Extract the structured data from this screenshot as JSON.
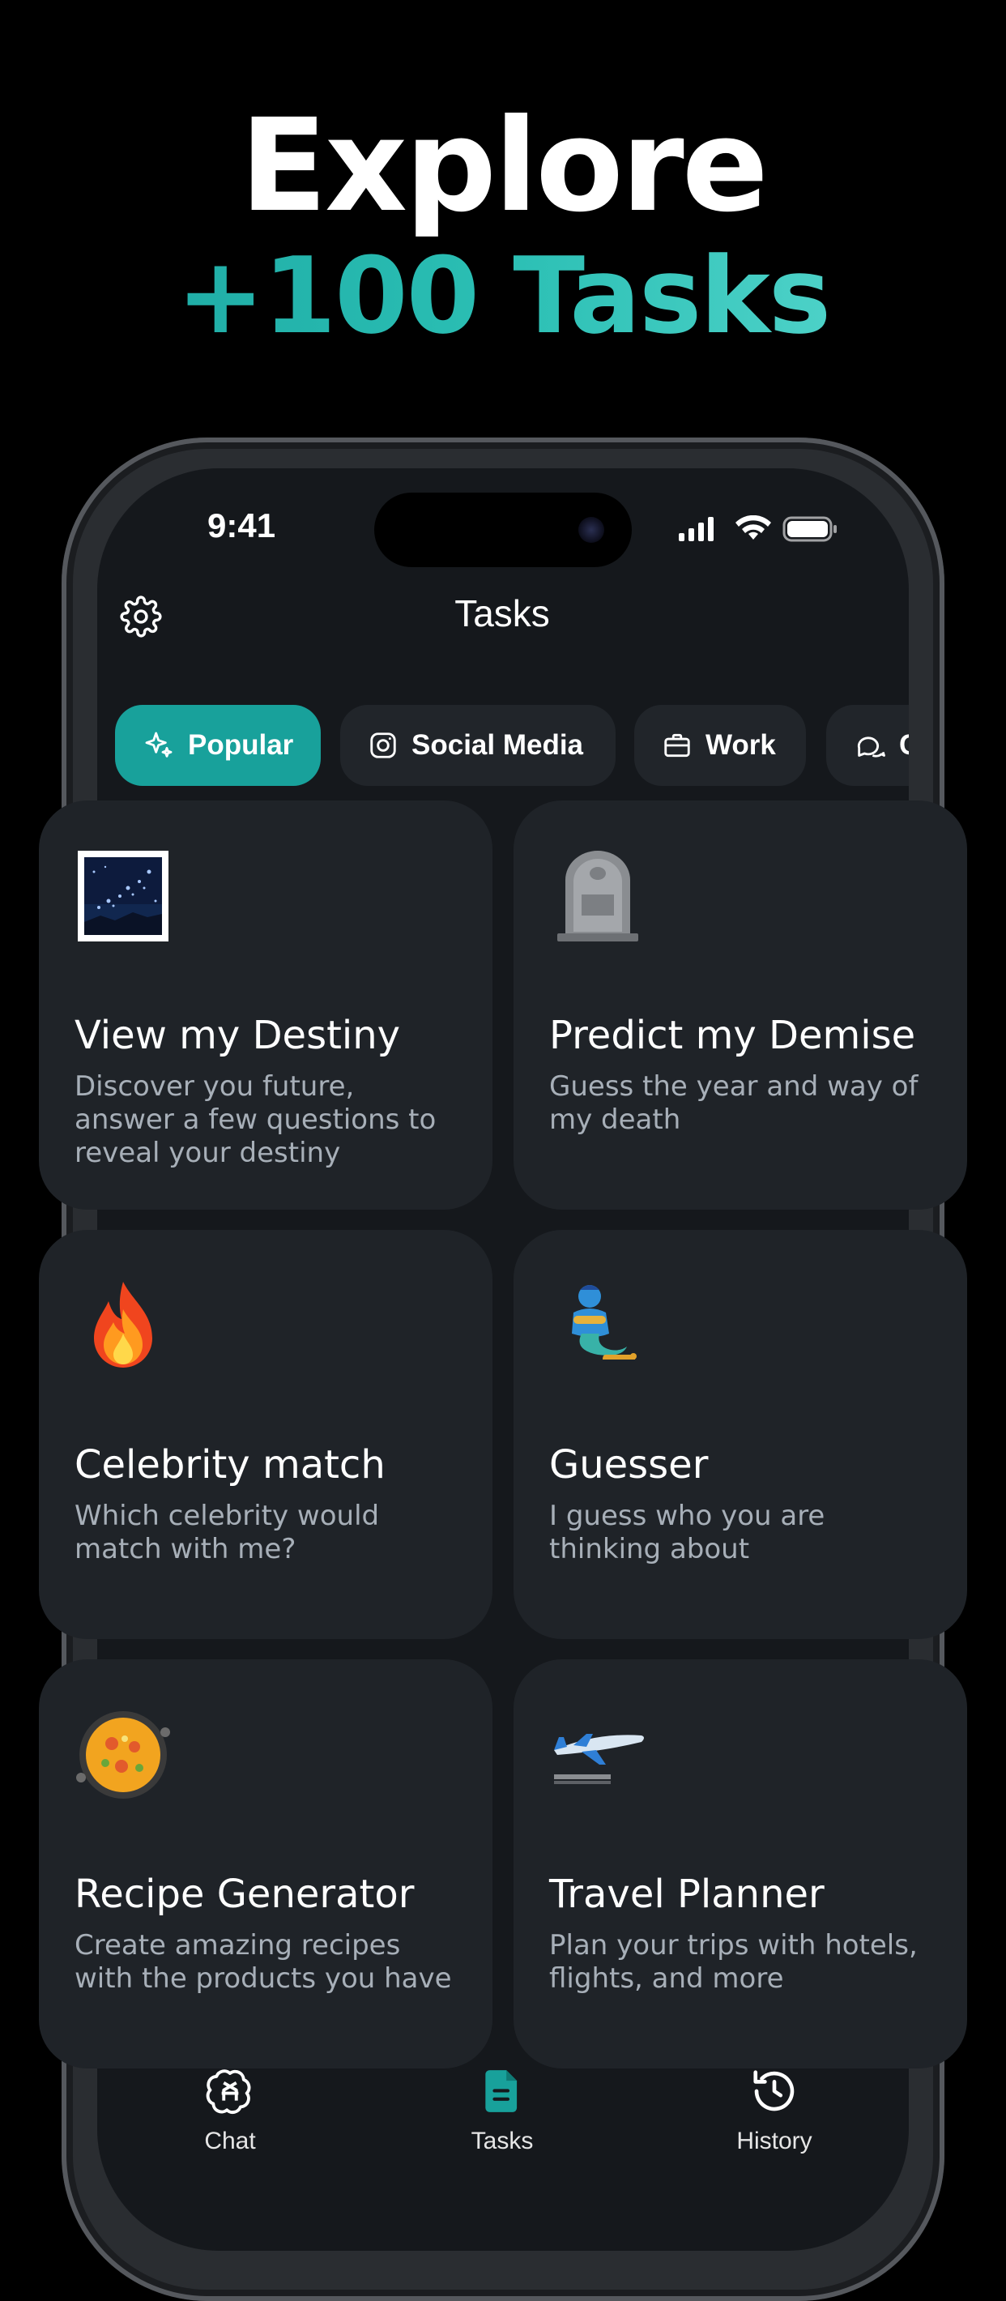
{
  "headline": {
    "line1": "Explore",
    "line2": "+100 Tasks"
  },
  "status": {
    "time": "9:41"
  },
  "nav": {
    "title": "Tasks"
  },
  "chips": [
    {
      "label": "Popular",
      "icon": "sparkles-icon",
      "active": true
    },
    {
      "label": "Social Media",
      "icon": "instagram-icon",
      "active": false
    },
    {
      "label": "Work",
      "icon": "briefcase-icon",
      "active": false
    },
    {
      "label": "C",
      "icon": "chat-bubbles-icon",
      "active": false
    }
  ],
  "cards": [
    {
      "emoji": "night-sky-icon",
      "title": "View my Destiny",
      "desc": "Discover you future, answer a few questions to reveal your destiny"
    },
    {
      "emoji": "headstone-icon",
      "title": "Predict my Demise",
      "desc": "Guess the year and way of my death"
    },
    {
      "emoji": "fire-icon",
      "title": "Celebrity match",
      "desc": "Which celebrity would match with me?"
    },
    {
      "emoji": "genie-icon",
      "title": "Guesser",
      "desc": "I guess who you are thinking about"
    },
    {
      "emoji": "paella-icon",
      "title": "Recipe Generator",
      "desc": "Create amazing recipes with the products you have"
    },
    {
      "emoji": "airplane-icon",
      "title": "Travel Planner",
      "desc": "Plan your trips with hotels, flights, and more"
    }
  ],
  "tabs": [
    {
      "label": "Chat",
      "icon": "openai-logo-icon",
      "active": false
    },
    {
      "label": "Tasks",
      "icon": "document-icon",
      "active": true
    },
    {
      "label": "History",
      "icon": "history-icon",
      "active": false
    }
  ],
  "colors": {
    "accent": "#18a19b",
    "background": "#000000",
    "card": "#1f2328",
    "chip": "#21252a",
    "muted_text": "#a7afb8"
  }
}
